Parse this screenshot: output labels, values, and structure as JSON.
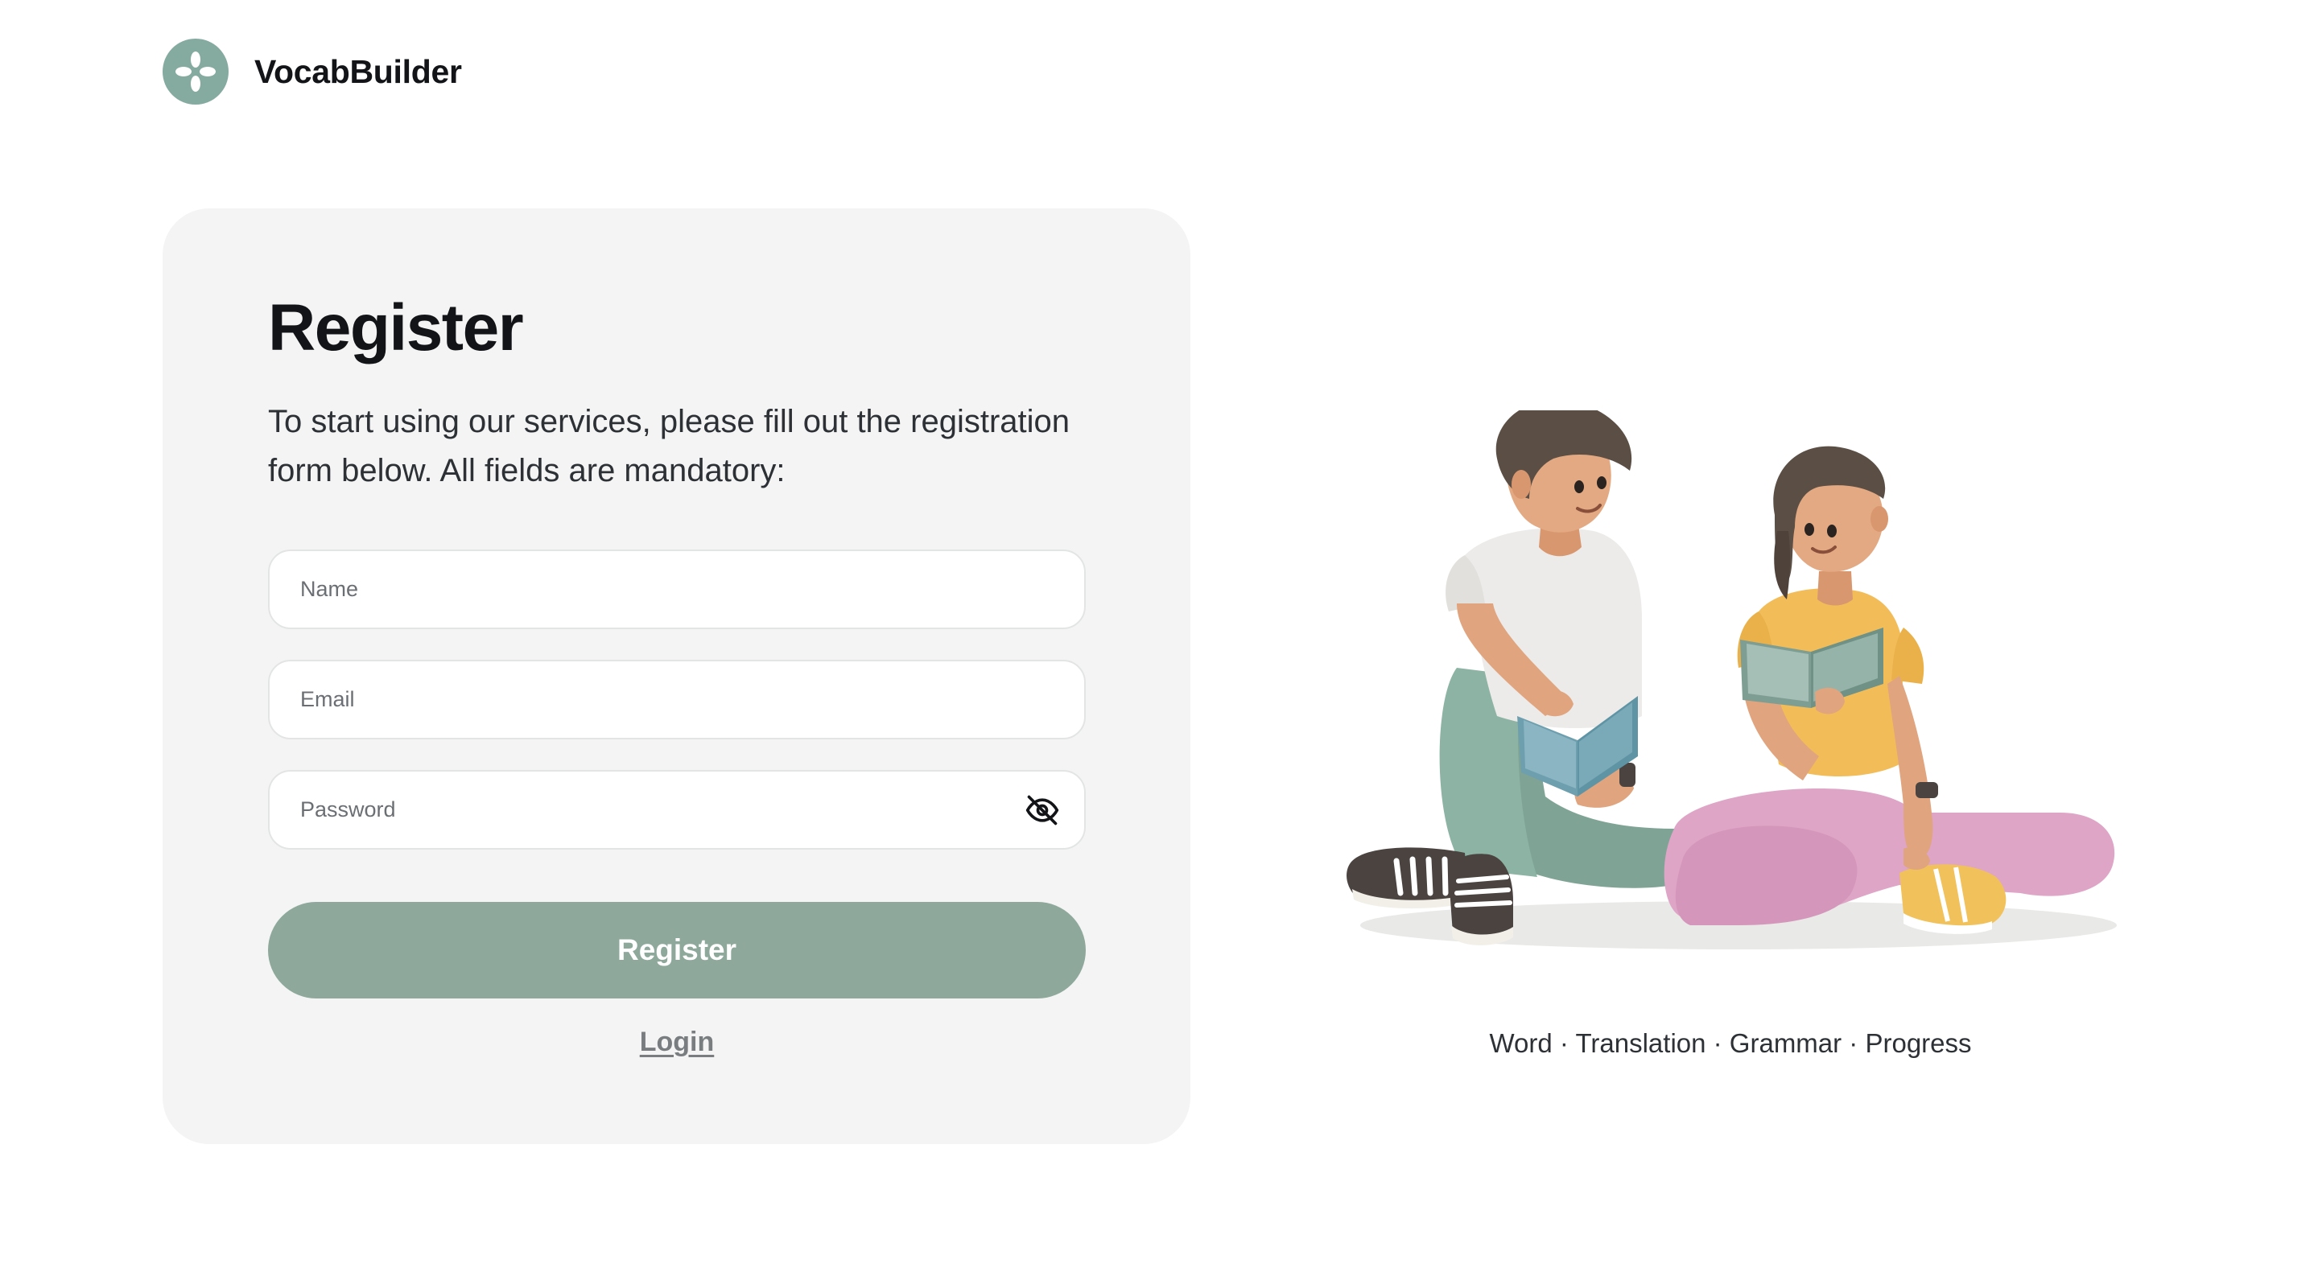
{
  "brand": {
    "name": "VocabBuilder",
    "logo_icon": "four-petal-flower-icon"
  },
  "register_form": {
    "title": "Register",
    "description": "To start using our services, please fill out the registration form below. All fields are mandatory:",
    "fields": {
      "name": {
        "placeholder": "Name",
        "value": ""
      },
      "email": {
        "placeholder": "Email",
        "value": ""
      },
      "password": {
        "placeholder": "Password",
        "value": "",
        "toggle_icon": "eye-off-icon"
      }
    },
    "submit_label": "Register",
    "login_link_label": "Login"
  },
  "illustration": {
    "subject": "two-people-reading-books"
  },
  "tagline": "Word · Translation · Grammar · Progress",
  "colors": {
    "accent": "#8ea89c",
    "logo_bg": "#85aa9f",
    "card_bg": "#f3f4f3",
    "text_primary": "#121417",
    "text_secondary": "#2d3136"
  }
}
